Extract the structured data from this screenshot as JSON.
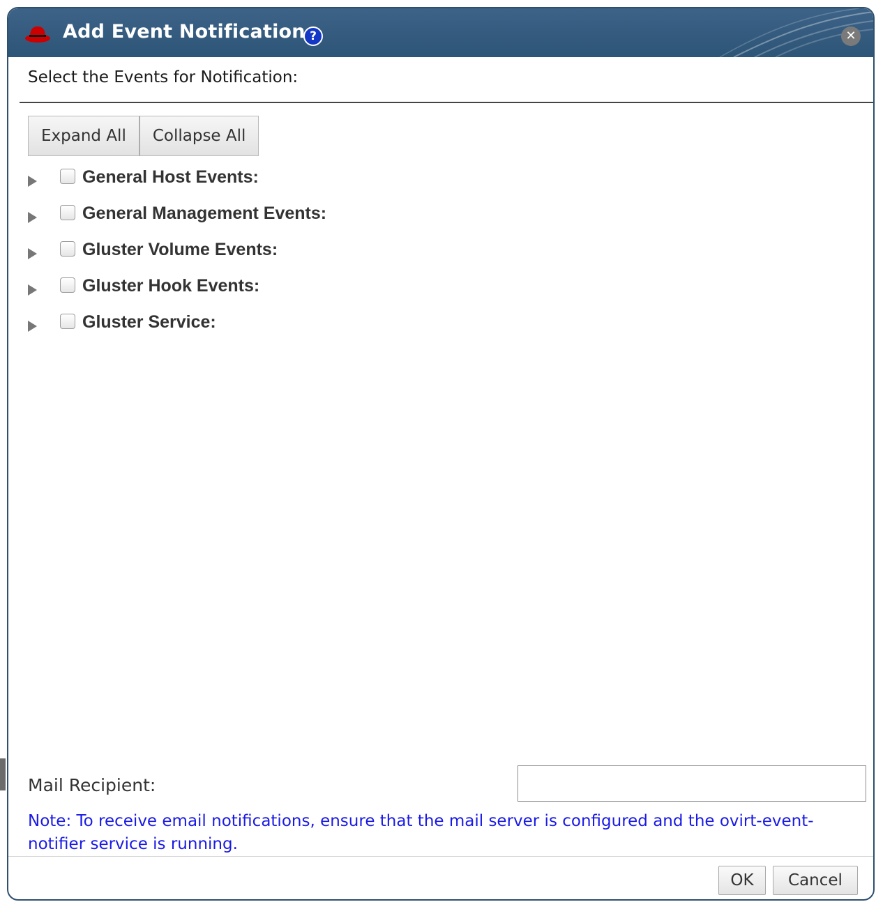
{
  "dialog": {
    "title": "Add Event Notification",
    "help_glyph": "?",
    "close_glyph": "✕",
    "icons": [
      "redhat-logo-icon",
      "help-icon",
      "close-icon"
    ]
  },
  "header": {
    "text": "Select the Events for Notification:"
  },
  "toolbar": {
    "expand_all_label": "Expand All",
    "collapse_all_label": "Collapse All"
  },
  "events": [
    {
      "label": "General Host Events:",
      "checked": false,
      "expanded": false
    },
    {
      "label": "General Management Events:",
      "checked": false,
      "expanded": false
    },
    {
      "label": "Gluster Volume Events:",
      "checked": false,
      "expanded": false
    },
    {
      "label": "Gluster Hook Events:",
      "checked": false,
      "expanded": false
    },
    {
      "label": "Gluster Service:",
      "checked": false,
      "expanded": false
    }
  ],
  "mail": {
    "label": "Mail Recipient:",
    "value": "",
    "placeholder": ""
  },
  "note": "Note: To receive email notifications, ensure that the mail server is configured and the ovirt-event-notifier service is running.",
  "footer": {
    "ok_label": "OK",
    "cancel_label": "Cancel"
  },
  "colors": {
    "titlebar": "#2d5577",
    "note_text": "#1a1ae6",
    "help_icon": "#1537c6",
    "logo_red": "#cc0000"
  }
}
